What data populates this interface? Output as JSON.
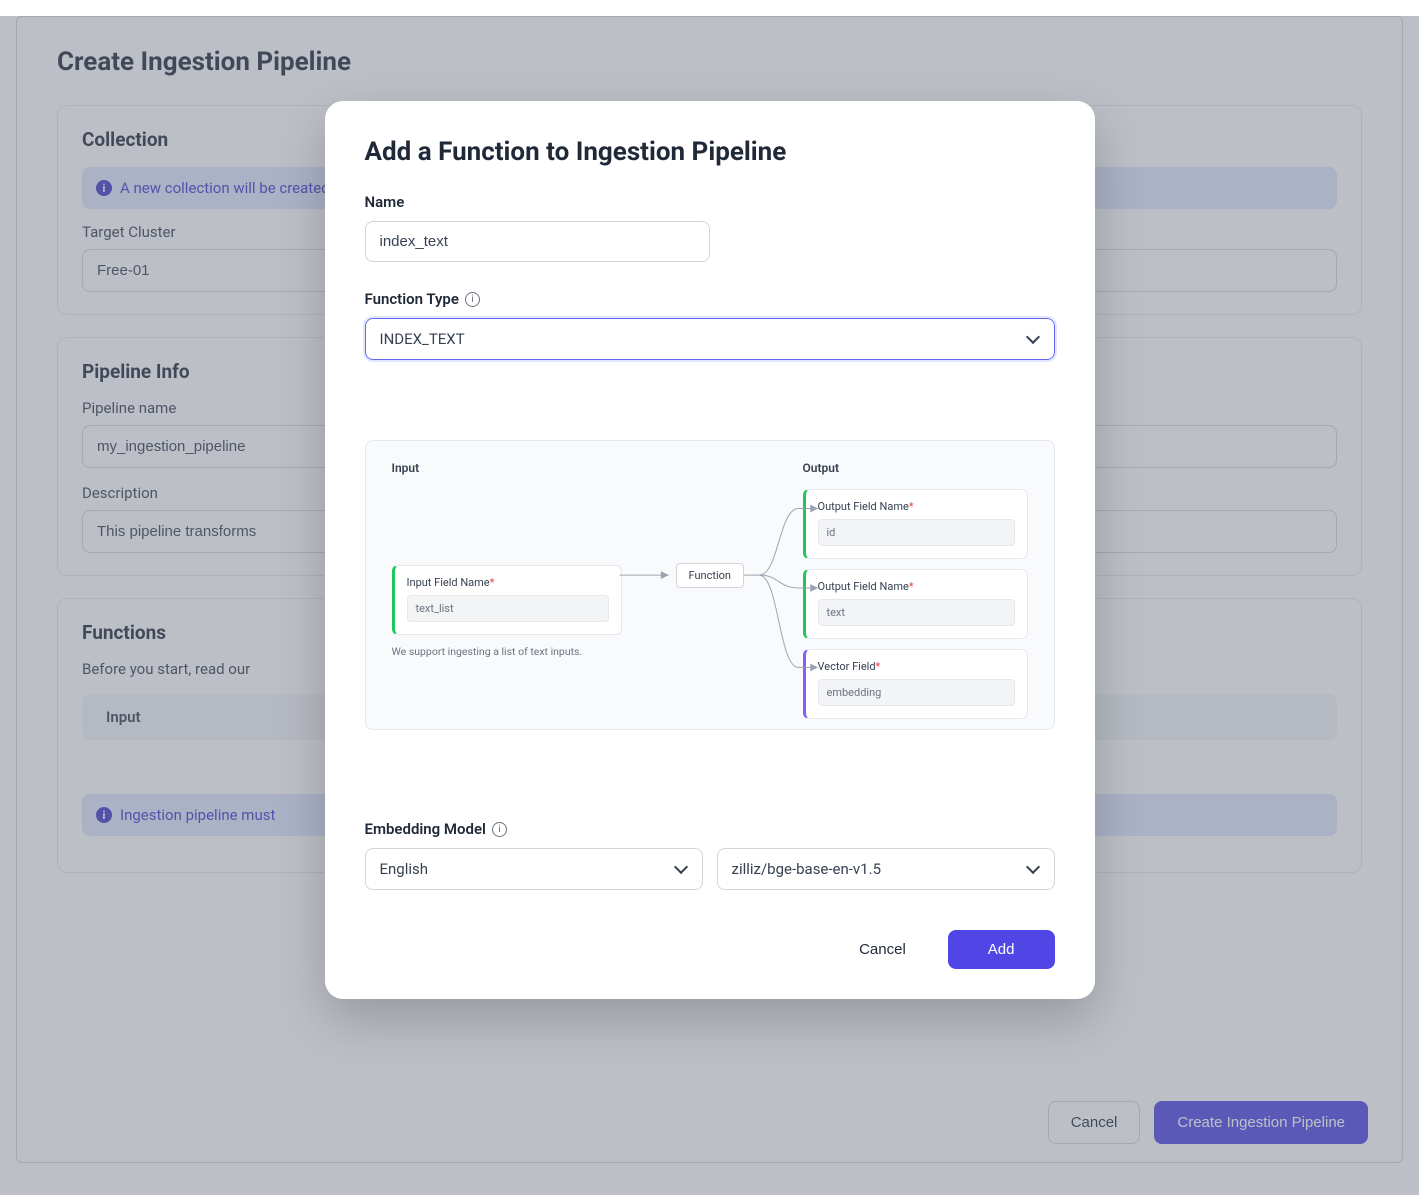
{
  "page": {
    "title": "Create Ingestion Pipeline",
    "collection": {
      "heading": "Collection",
      "banner": "A new collection will be created",
      "target_cluster_label": "Target Cluster",
      "target_cluster_value": "Free-01"
    },
    "pipeline_info": {
      "heading": "Pipeline Info",
      "name_label": "Pipeline name",
      "name_value": "my_ingestion_pipeline",
      "desc_label": "Description",
      "desc_value": "This pipeline transforms"
    },
    "functions": {
      "heading": "Functions",
      "intro": "Before you start, read our",
      "table_header_input": "Input",
      "banner": "Ingestion pipeline must"
    },
    "footer": {
      "cancel": "Cancel",
      "create": "Create Ingestion Pipeline"
    }
  },
  "modal": {
    "title": "Add a Function to Ingestion Pipeline",
    "name_label": "Name",
    "name_value": "index_text",
    "fn_type_label": "Function Type",
    "fn_type_value": "INDEX_TEXT",
    "diagram": {
      "input_heading": "Input",
      "output_heading": "Output",
      "input_field_label": "Input Field Name",
      "input_field_value": "text_list",
      "helper": "We support ingesting a list of text inputs.",
      "fn_box": "Function",
      "out1_label": "Output Field Name",
      "out1_value": "id",
      "out2_label": "Output Field Name",
      "out2_value": "text",
      "out3_label": "Vector Field",
      "out3_value": "embedding"
    },
    "embedding_label": "Embedding Model",
    "embedding_lang": "English",
    "embedding_model": "zilliz/bge-base-en-v1.5",
    "cancel": "Cancel",
    "add": "Add"
  }
}
